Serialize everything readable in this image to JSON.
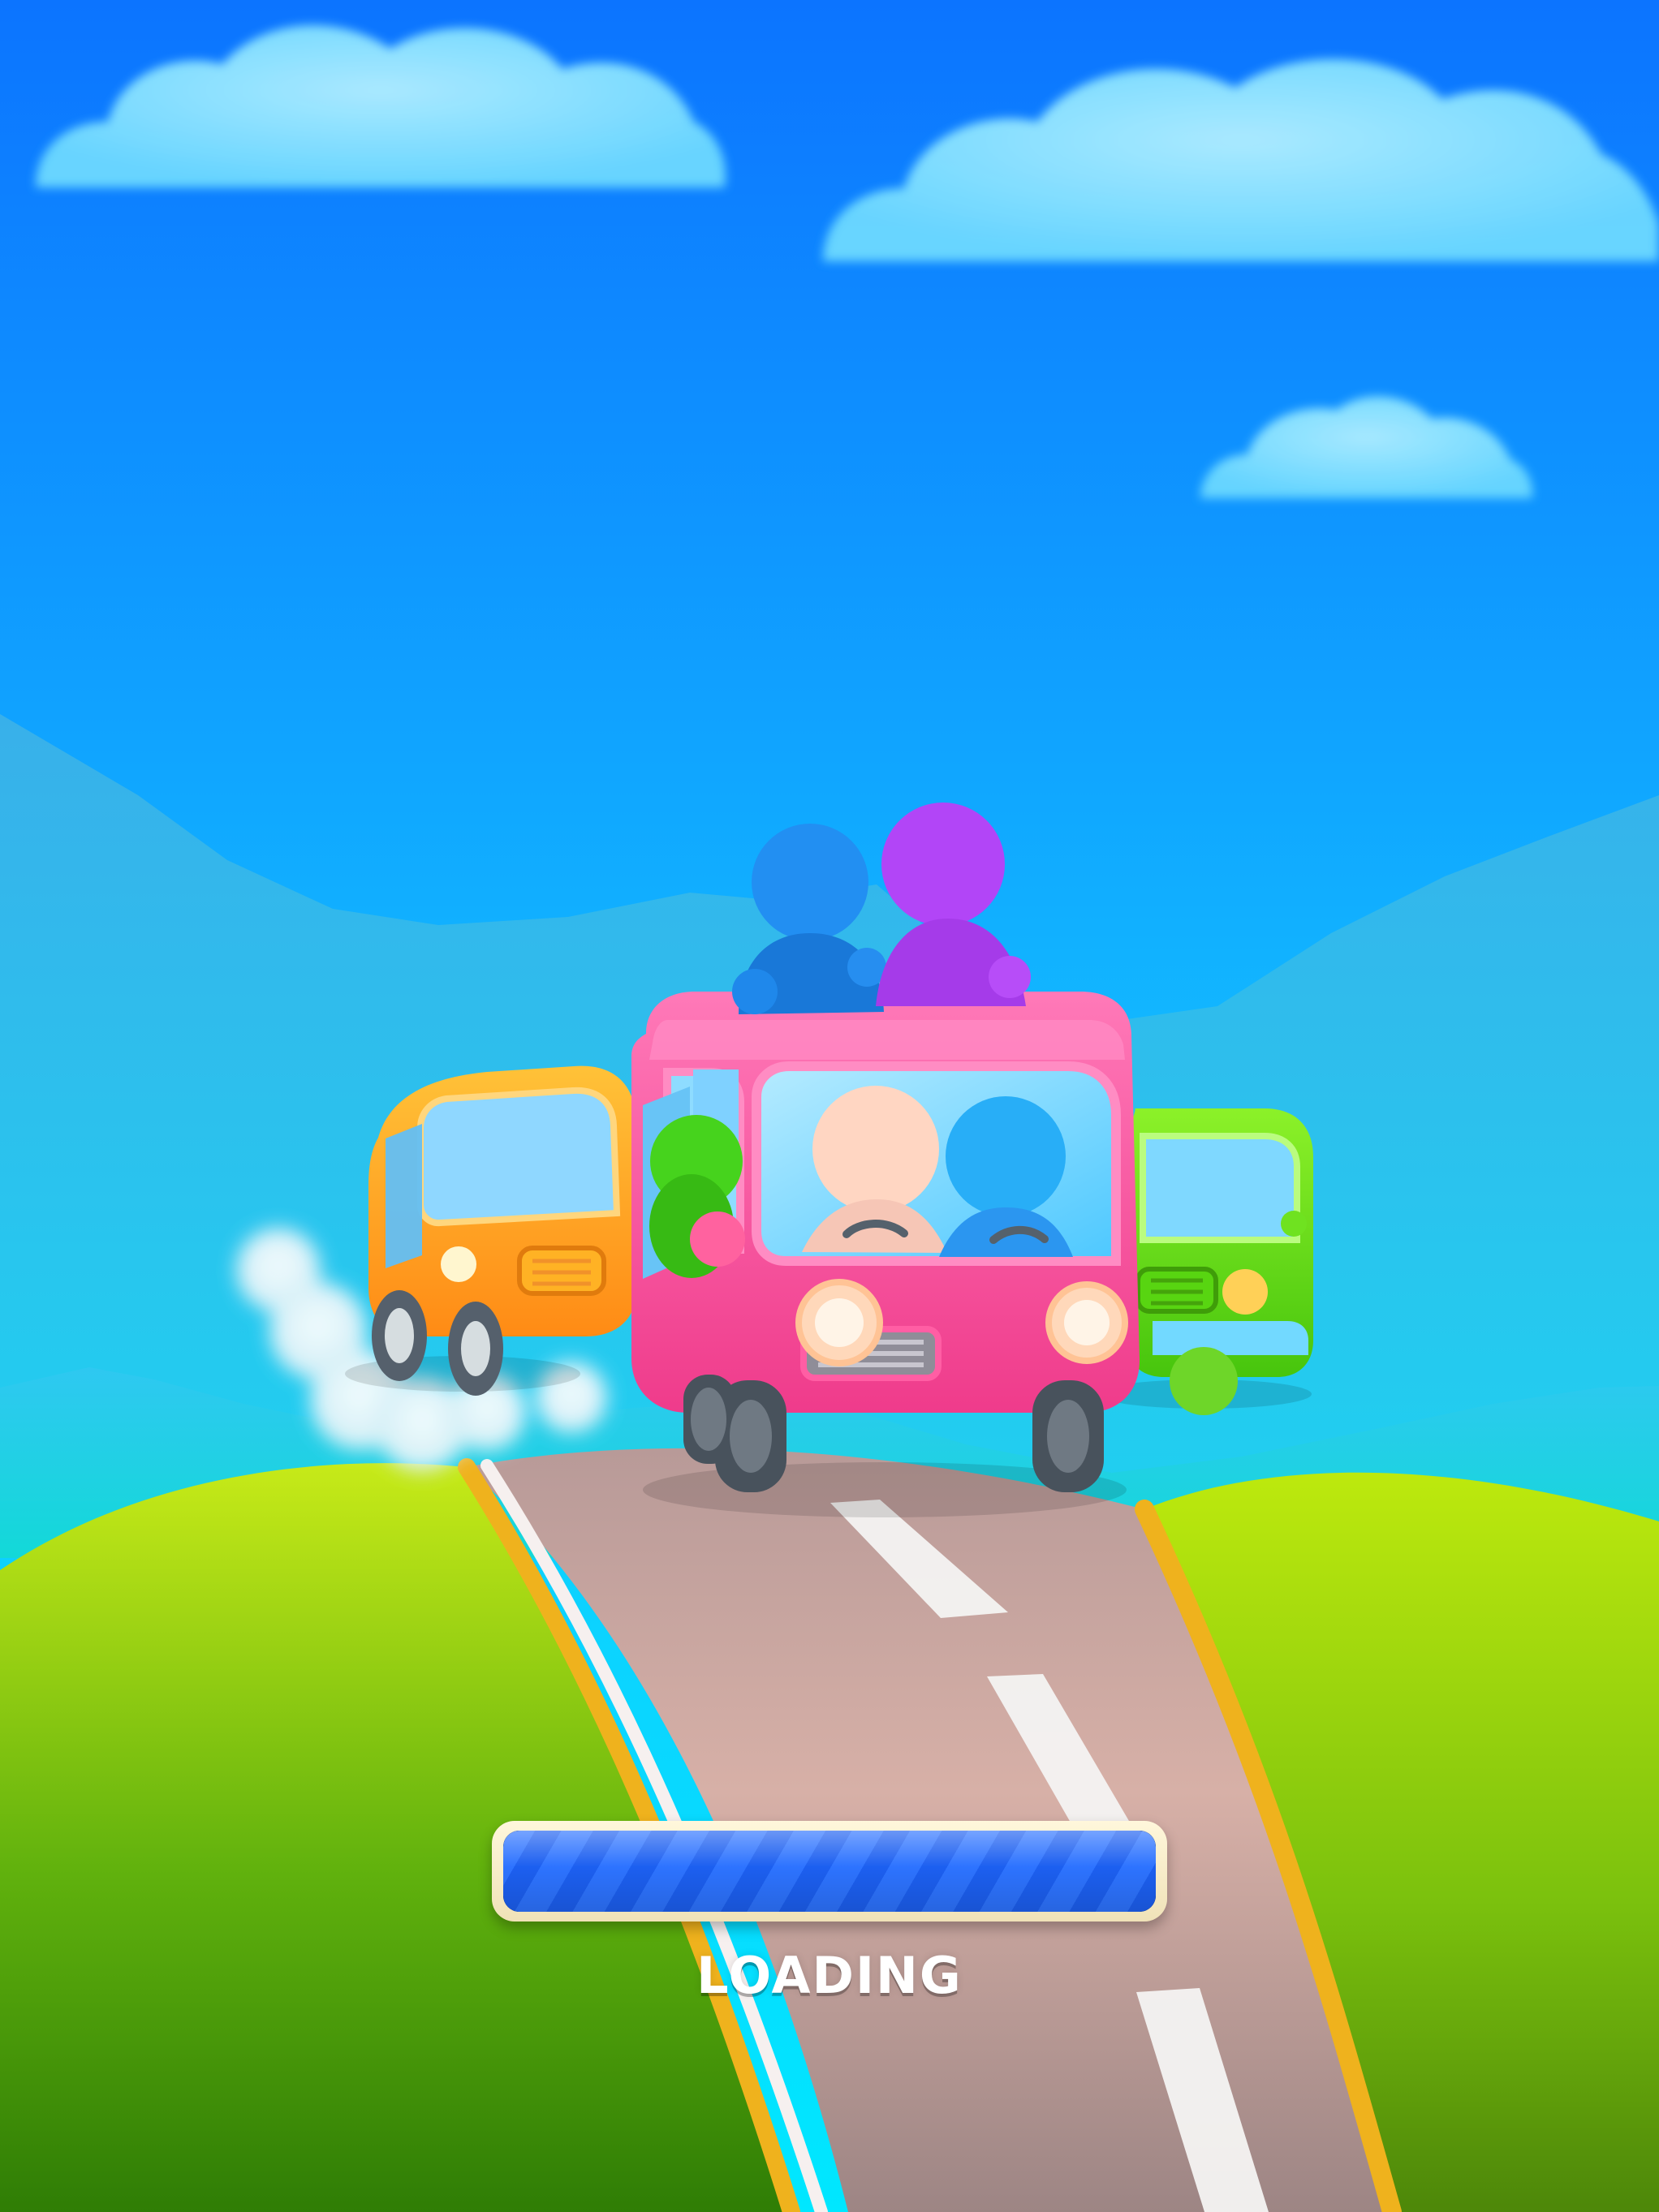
{
  "loading": {
    "label": "LOADING",
    "progress": 1.0
  },
  "colors": {
    "sky_top": "#0c74ff",
    "sky_bottom": "#00e7ff",
    "mountain_far": "#33b9e8",
    "mountain_mid": "#22c9f0",
    "hill_left_top": "#c8ea17",
    "hill_left_bottom": "#2f7d05",
    "hill_right_top": "#b6e80c",
    "hill_right_bottom": "#5e9c10",
    "road": "#cda9a1",
    "road_edge": "#efb21d",
    "lane_marking": "#f6f0ef",
    "bus_pink": "#ff4f9c",
    "car_orange": "#ffa320",
    "car_green": "#65d91c",
    "loading_fill": "#2d73ff",
    "loading_frame": "#fff4d7"
  }
}
